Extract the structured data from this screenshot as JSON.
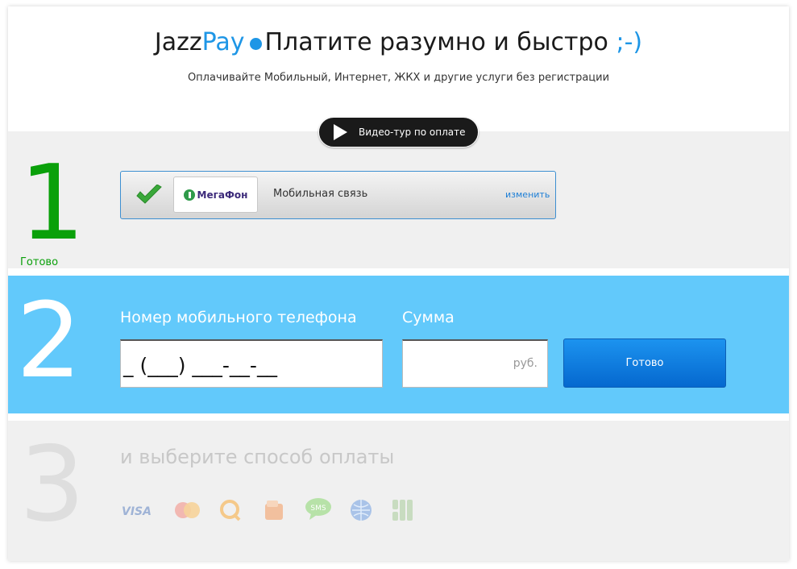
{
  "header": {
    "brand_first": "Jazz",
    "brand_second": "Pay",
    "tagline": "Платите разумно и быстро",
    "smile": ";-)",
    "subtitle": "Оплачивайте Мобильный, Интернет, ЖКХ и другие услуги без регистрации"
  },
  "video": {
    "label": "Видео-тур по оплате",
    "icon": "play-icon"
  },
  "step1": {
    "number": "1",
    "status": "Готово",
    "operator_logo": "МегаФон",
    "operator_service": "Мобильная связь",
    "change_label": "изменить"
  },
  "step2": {
    "number": "2",
    "phone_label": "Номер мобильного телефона",
    "phone_value": "_ (___) ___-__-__",
    "sum_label": "Сумма",
    "sum_value": "",
    "currency": "руб.",
    "submit_label": "Готово"
  },
  "step3": {
    "number": "3",
    "label": "и выберите способ оплаты",
    "methods": [
      {
        "name": "visa-icon",
        "text": "VISA"
      },
      {
        "name": "mastercard-icon"
      },
      {
        "name": "qiwi-icon"
      },
      {
        "name": "wallet-icon"
      },
      {
        "name": "sms-icon",
        "text": "SMS"
      },
      {
        "name": "webmoney-icon"
      },
      {
        "name": "terminal-icon"
      }
    ]
  },
  "colors": {
    "accent_blue": "#1e96e6",
    "step1_green": "#0aa00a",
    "step2_bg": "#62c9fb",
    "button_blue": "#0b7ee0",
    "panel_gray": "#f0f0f0"
  }
}
